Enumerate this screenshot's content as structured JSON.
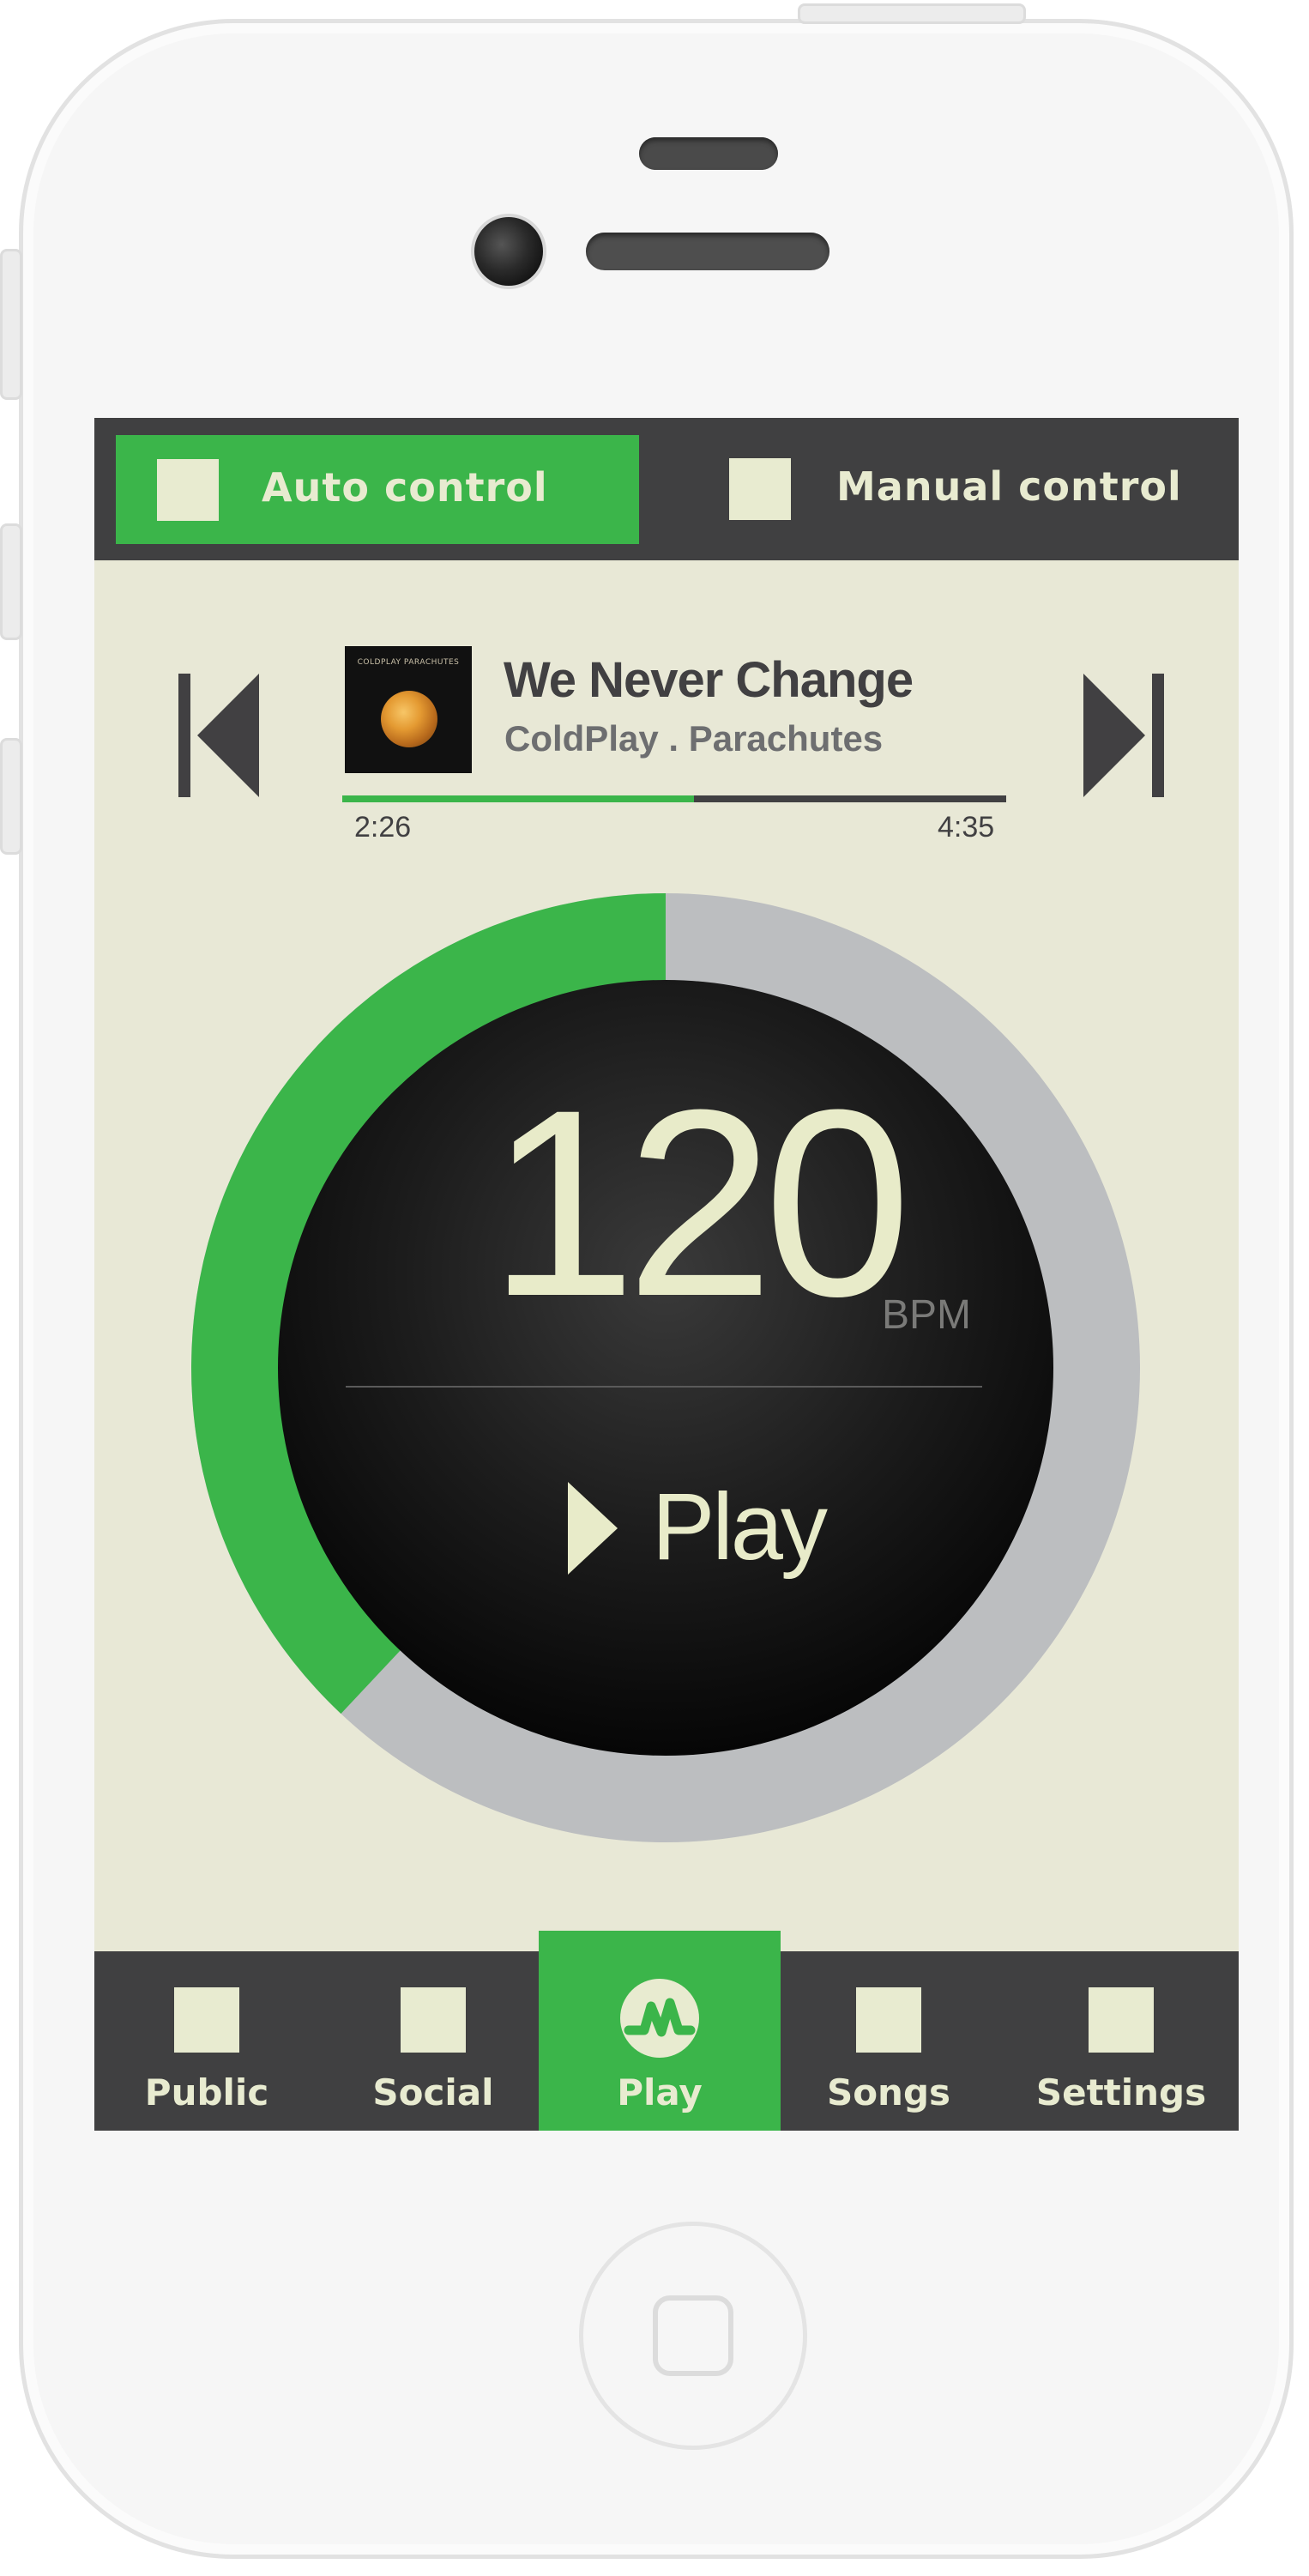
{
  "mode_bar": {
    "auto_label": "Auto control",
    "manual_label": "Manual control",
    "selected": "auto"
  },
  "now_playing": {
    "album_art_text": "COLDPLAY PARACHUTES",
    "title": "We Never Change",
    "artist_album": "ColdPlay . Parachutes",
    "current_time": "2:26",
    "total_time": "4:35",
    "progress": 0.53
  },
  "dial": {
    "bpm": "120",
    "unit": "BPM",
    "play_label": "Play",
    "level": 0.38
  },
  "tabs": [
    {
      "label": "Public",
      "icon": "square-icon"
    },
    {
      "label": "Social",
      "icon": "square-icon"
    },
    {
      "label": "Play",
      "icon": "pulse-logo-icon",
      "active": true
    },
    {
      "label": "Songs",
      "icon": "square-icon"
    },
    {
      "label": "Settings",
      "icon": "square-icon"
    }
  ],
  "colors": {
    "accent": "#3bb54a",
    "dark": "#404041",
    "screen_bg": "#e8e8d6",
    "cream": "#e8ebd0",
    "ring_track": "#bcbec0"
  }
}
